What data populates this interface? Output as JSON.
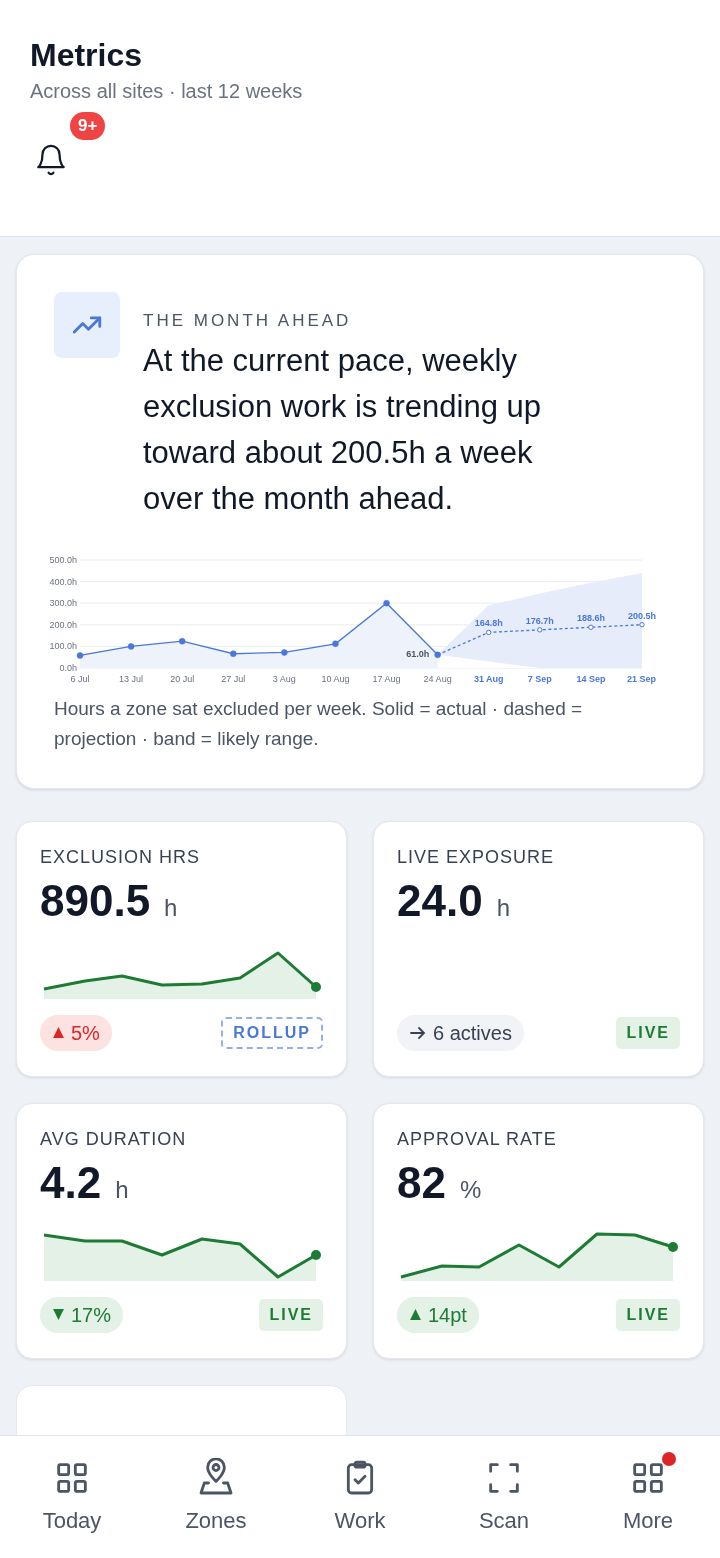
{
  "header": {
    "title": "Metrics",
    "subtitle": "Across all sites · last 12 weeks",
    "notifications": {
      "badge": "9+"
    }
  },
  "forecast": {
    "eyebrow": "THE MONTH AHEAD",
    "headline": "At the current pace, weekly exclusion work is trending up toward about 200.5h a week over the month ahead.",
    "caption": "Hours a zone sat excluded per week. Solid = actual · dashed = projection · band = likely range.",
    "chart_data": {
      "type": "line",
      "categories": [
        "6 Jul",
        "13 Jul",
        "20 Jul",
        "27 Jul",
        "3 Aug",
        "10 Aug",
        "17 Aug",
        "24 Aug",
        "31 Aug",
        "7 Sep",
        "14 Sep",
        "21 Sep"
      ],
      "yticks": [
        {
          "value": 0,
          "label": "0.0h"
        },
        {
          "value": 100,
          "label": "100.0h"
        },
        {
          "value": 200,
          "label": "200.0h"
        },
        {
          "value": 300,
          "label": "300.0h"
        },
        {
          "value": 400,
          "label": "400.0h"
        },
        {
          "value": 500,
          "label": "500.0h"
        }
      ],
      "ylim": [
        0,
        500
      ],
      "grid": true,
      "series": [
        {
          "line_style": "solid",
          "marker": "circle",
          "color": "#4a78d8",
          "values": [
            58,
            100,
            124,
            66,
            72,
            112,
            300,
            61,
            null,
            null,
            null,
            null
          ]
        },
        {
          "line_style": "dashed",
          "marker": "circle",
          "color": "#4a78d8",
          "values": [
            null,
            null,
            null,
            null,
            null,
            null,
            null,
            61,
            164.8,
            176.7,
            188.6,
            200.5
          ],
          "value_labels": [
            null,
            null,
            null,
            null,
            null,
            null,
            null,
            "61.0h",
            "164.8h",
            "176.7h",
            "188.6h",
            "200.5h"
          ]
        },
        {
          "type": "area",
          "color": "#e6ecfa",
          "values": [
            null,
            null,
            null,
            null,
            null,
            null,
            null,
            61,
            290,
            345,
            395,
            440
          ]
        },
        {
          "type": "area",
          "color": "#ffffff",
          "values": [
            null,
            null,
            null,
            null,
            null,
            null,
            null,
            61,
            30,
            0,
            0,
            0
          ]
        }
      ]
    }
  },
  "metrics": [
    {
      "label": "EXCLUSION HRS",
      "value": "890.5",
      "unit": "h",
      "sparkline": true,
      "trend": {
        "kind": "rise-bad",
        "text": "5%"
      },
      "badge": {
        "kind": "rollup",
        "text": "ROLLUP"
      }
    },
    {
      "label": "LIVE EXPOSURE",
      "value": "24.0",
      "unit": "h",
      "sparkline": false,
      "trend": {
        "kind": "info",
        "text": "6 actives"
      },
      "badge": {
        "kind": "live",
        "text": "LIVE"
      }
    },
    {
      "label": "AVG DURATION",
      "value": "4.2",
      "unit": "h",
      "sparkline": true,
      "trend": {
        "kind": "fall-good",
        "text": "17%"
      },
      "badge": {
        "kind": "live",
        "text": "LIVE"
      }
    },
    {
      "label": "APPROVAL RATE",
      "value": "82",
      "unit": "%",
      "sparkline": true,
      "trend": {
        "kind": "rise-good",
        "text": "14pt"
      },
      "badge": {
        "kind": "live",
        "text": "LIVE"
      }
    }
  ],
  "nav": [
    {
      "label": "Today",
      "selected": false,
      "dot": false
    },
    {
      "label": "Zones",
      "selected": false,
      "dot": false
    },
    {
      "label": "Work",
      "selected": false,
      "dot": false
    },
    {
      "label": "Scan",
      "selected": false,
      "dot": false
    },
    {
      "label": "More",
      "selected": false,
      "dot": true
    }
  ]
}
